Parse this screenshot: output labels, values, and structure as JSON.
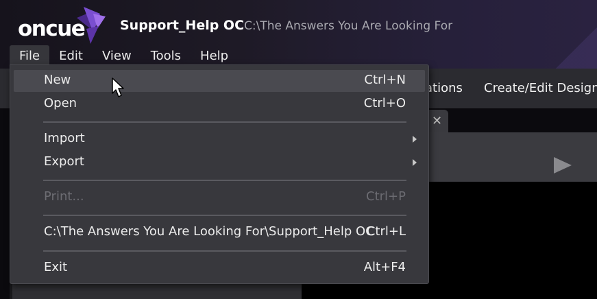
{
  "app": {
    "logo_text": "oncue",
    "title": "Support_Help OC",
    "path": "C:\\The Answers You Are Looking For"
  },
  "menubar": {
    "items": [
      {
        "label": "File",
        "active": true
      },
      {
        "label": "Edit"
      },
      {
        "label": "View"
      },
      {
        "label": "Tools"
      },
      {
        "label": "Help"
      }
    ]
  },
  "background": {
    "tabs": [
      "ations",
      "Create/Edit Designa"
    ],
    "close_glyph": "✕"
  },
  "file_menu": {
    "items": [
      {
        "label": "New",
        "shortcut": "Ctrl+N",
        "hover": true
      },
      {
        "label": "Open",
        "shortcut": "Ctrl+O"
      },
      {
        "label": "Import",
        "submenu": true
      },
      {
        "label": "Export",
        "submenu": true
      },
      {
        "label": "Print...",
        "shortcut": "Ctrl+P",
        "disabled": true
      },
      {
        "label": "C:\\The Answers You Are Looking For\\Support_Help OC",
        "shortcut": "Ctrl+L"
      },
      {
        "label": "Exit",
        "shortcut": "Alt+F4"
      }
    ]
  },
  "colors": {
    "accent_purple": "#7a4fd0",
    "menu_bg": "#38383d",
    "hover_bg": "#4a4a50"
  }
}
